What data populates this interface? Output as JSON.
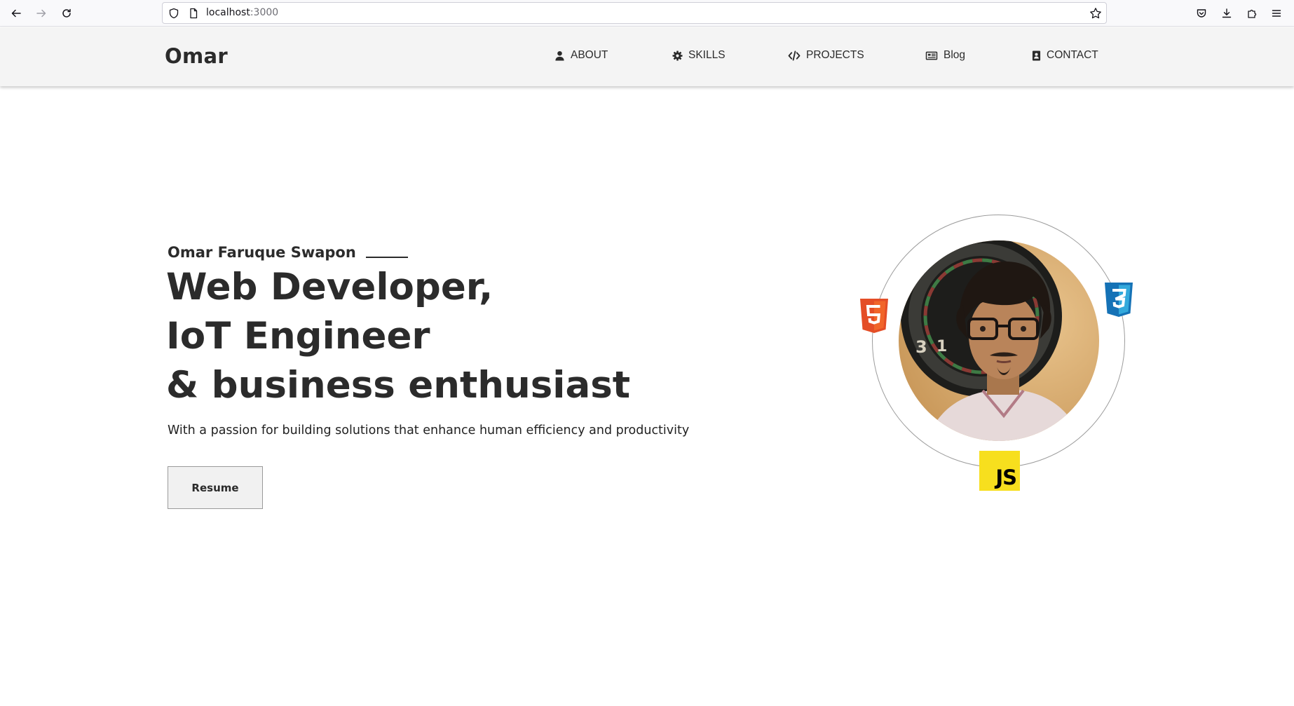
{
  "browser": {
    "url_host": "localhost",
    "url_port": ":3000"
  },
  "header": {
    "brand": "Omar",
    "nav": [
      {
        "label": "ABOUT",
        "icon": "user-icon"
      },
      {
        "label": "SKILLS",
        "icon": "gear-icon"
      },
      {
        "label": "PROJECTS",
        "icon": "code-icon"
      },
      {
        "label": "Blog",
        "icon": "newspaper-icon"
      },
      {
        "label": "CONTACT",
        "icon": "address-book-icon"
      }
    ]
  },
  "hero": {
    "name": "Omar Faruque Swapon",
    "title_lines": [
      "Web Developer,",
      "IoT Engineer",
      "& business enthusiast"
    ],
    "tagline": "With a passion for building solutions that enhance human efficiency and productivity",
    "resume_label": "Resume"
  },
  "profile": {
    "badges": [
      "html5-icon",
      "css3-icon",
      "javascript-icon"
    ],
    "js_badge_text": "JS"
  },
  "colors": {
    "header_bg": "#f4f4f4",
    "text": "#2b2b2b",
    "html5": "#e44d26",
    "css3": "#1572b6",
    "js": "#f7df1e"
  }
}
